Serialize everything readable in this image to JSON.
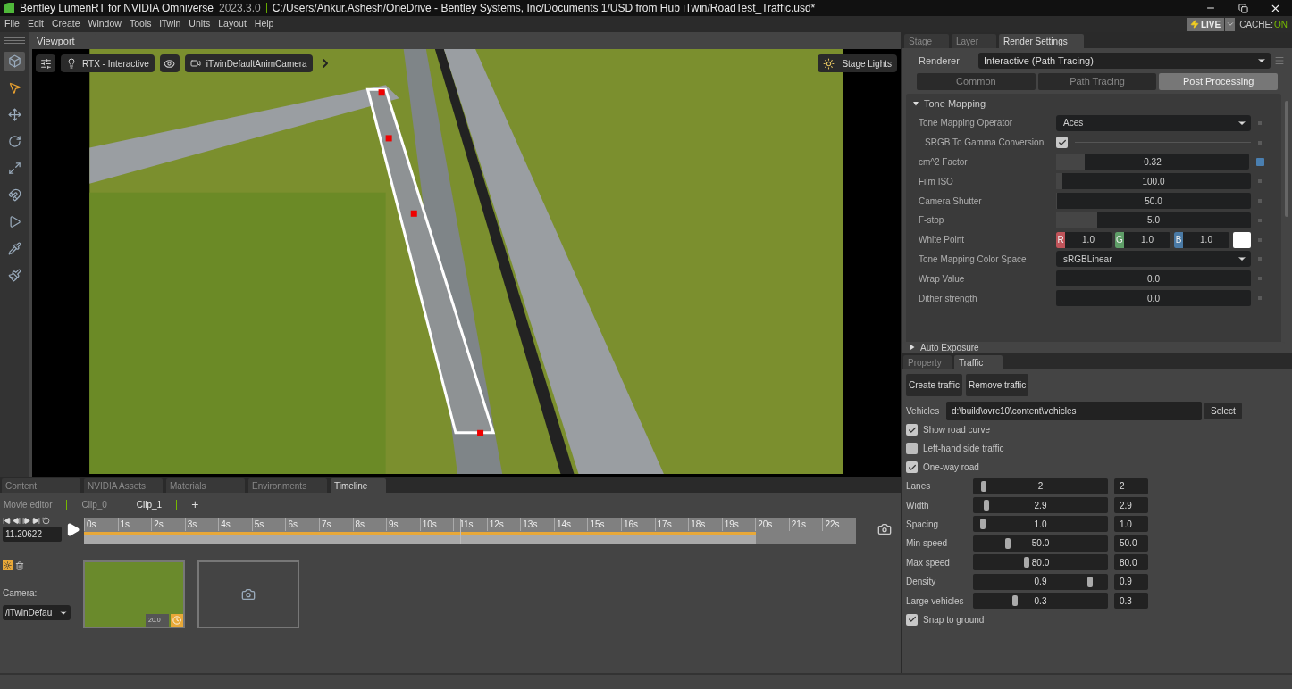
{
  "window": {
    "app_name": "Bentley LumenRT for NVIDIA Omniverse",
    "version": "2023.3.0",
    "path": "C:/Users/Ankur.Ashesh/OneDrive - Bentley Systems, Inc/Documents 1/USD from Hub iTwin/RoadTest_Traffic.usd*"
  },
  "menu": [
    "File",
    "Edit",
    "Create",
    "Window",
    "Tools",
    "iTwin",
    "Units",
    "Layout",
    "Help"
  ],
  "live": {
    "label": "LIVE",
    "cache_label": "CACHE:",
    "cache_value": "ON"
  },
  "viewport": {
    "tab": "Viewport",
    "render_mode": "RTX - Interactive",
    "camera": "iTwinDefaultAnimCamera",
    "lights": "Stage Lights"
  },
  "bottom_tabs": [
    {
      "label": "Content",
      "selected": false
    },
    {
      "label": "NVIDIA Assets",
      "selected": false
    },
    {
      "label": "Materials",
      "selected": false
    },
    {
      "label": "Environments",
      "selected": false
    },
    {
      "label": "Timeline",
      "selected": true
    }
  ],
  "clips": [
    {
      "label": "Movie editor",
      "selected": false
    },
    {
      "label": "Clip_0",
      "selected": false
    },
    {
      "label": "Clip_1",
      "selected": true
    }
  ],
  "add_clip": "+",
  "timeline": {
    "time": "11.20622",
    "ticks": [
      "0s",
      "1s",
      "2s",
      "3s",
      "4s",
      "5s",
      "6s",
      "7s",
      "8s",
      "9s",
      "10s",
      "11s",
      "12s",
      "13s",
      "14s",
      "15s",
      "16s",
      "17s",
      "18s",
      "19s",
      "20s",
      "21s",
      "22s"
    ],
    "playhead": {
      "level": 0.487
    },
    "clip_range": {
      "level": 0.87
    },
    "camera_label": "Camera:",
    "camera_value": "/iTwinDefau",
    "keyframe_duration": "20.0"
  },
  "right_tabs": [
    {
      "label": "Stage",
      "selected": false
    },
    {
      "label": "Layer",
      "selected": false
    },
    {
      "label": "Render Settings",
      "selected": true
    }
  ],
  "renderer": {
    "label": "Renderer",
    "value": "Interactive (Path Tracing)"
  },
  "render_subtabs": [
    {
      "label": "Common",
      "selected": false
    },
    {
      "label": "Path Tracing",
      "selected": false
    },
    {
      "label": "Post Processing",
      "selected": true
    }
  ],
  "tone_mapping": {
    "title": "Tone Mapping",
    "expanded": true,
    "rows": [
      {
        "kind": "dropdown",
        "label": "Tone Mapping Operator",
        "value": "Aces"
      },
      {
        "kind": "checkbox",
        "label": "SRGB To Gamma Conversion",
        "checked": true
      },
      {
        "kind": "slider",
        "label": "cm^2 Factor",
        "value": "0.32",
        "level": 0.15,
        "modified": true
      },
      {
        "kind": "slider",
        "label": "Film ISO",
        "value": "100.0",
        "level": 0.03,
        "modified": false
      },
      {
        "kind": "slider",
        "label": "Camera Shutter",
        "value": "50.0",
        "level": 0.005,
        "modified": false
      },
      {
        "kind": "slider",
        "label": "F-stop",
        "value": "5.0",
        "level": 0.21,
        "modified": false
      },
      {
        "kind": "color",
        "label": "White Point",
        "channels": [
          {
            "name": "R",
            "value": "1.0",
            "color": "#c0545a"
          },
          {
            "name": "G",
            "value": "1.0",
            "color": "#5f9e68"
          },
          {
            "name": "B",
            "value": "1.0",
            "color": "#4a7aa6"
          }
        ]
      },
      {
        "kind": "dropdown",
        "label": "Tone Mapping Color Space",
        "value": "sRGBLinear"
      },
      {
        "kind": "slider",
        "label": "Wrap Value",
        "value": "0.0",
        "level": 0,
        "modified": false
      },
      {
        "kind": "slider",
        "label": "Dither strength",
        "value": "0.0",
        "level": 0,
        "modified": false
      }
    ]
  },
  "auto_exposure": {
    "title": "Auto Exposure",
    "expanded": false
  },
  "lower_tabs": [
    {
      "label": "Property",
      "selected": false
    },
    {
      "label": "Traffic",
      "selected": true
    }
  ],
  "traffic": {
    "buttons": [
      "Create traffic",
      "Remove traffic"
    ],
    "vehicles_label": "Vehicles",
    "vehicles_path": "d:\\build\\ovrc10\\content\\vehicles",
    "select_button": "Select",
    "options": [
      {
        "label": "Show road curve",
        "checked": true
      },
      {
        "label": "Left-hand side traffic",
        "checked": false
      },
      {
        "label": "One-way road",
        "checked": true
      }
    ],
    "sliders": [
      {
        "label": "Lanes",
        "value": "2",
        "level": 0.08,
        "field": "2"
      },
      {
        "label": "Width",
        "value": "2.9",
        "level": 0.1,
        "field": "2.9"
      },
      {
        "label": "Spacing",
        "value": "1.0",
        "level": 0.07,
        "field": "1.0"
      },
      {
        "label": "Min speed",
        "value": "50.0",
        "level": 0.26,
        "field": "50.0"
      },
      {
        "label": "Max speed",
        "value": "80.0",
        "level": 0.4,
        "field": "80.0"
      },
      {
        "label": "Density",
        "value": "0.9",
        "level": 0.87,
        "field": "0.9"
      },
      {
        "label": "Large vehicles",
        "value": "0.3",
        "level": 0.31,
        "field": "0.3"
      }
    ],
    "snap": {
      "label": "Snap to ground",
      "checked": true
    }
  }
}
